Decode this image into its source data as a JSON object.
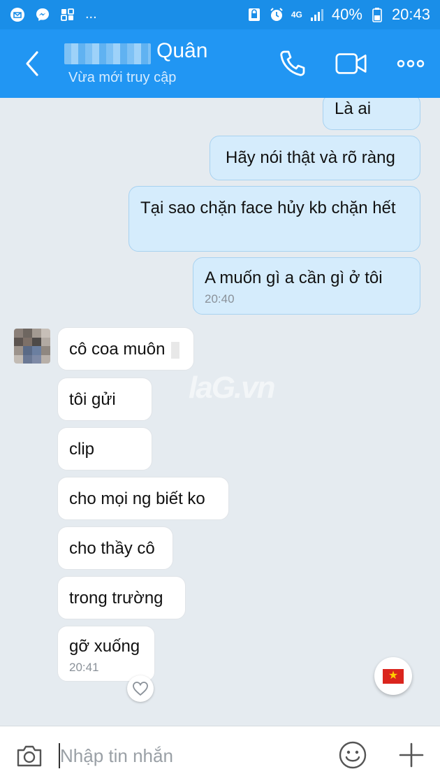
{
  "status_bar": {
    "more_indicator": "...",
    "network_label": "4G",
    "battery_percent": "40%",
    "time": "20:43"
  },
  "header": {
    "contact_name": "Quân",
    "contact_status": "Vừa mới truy cập"
  },
  "messages": [
    {
      "side": "me",
      "text": "Là ai"
    },
    {
      "side": "me",
      "text": "Hãy nói thật và rõ ràng"
    },
    {
      "side": "me",
      "text": "Tại sao chặn face   hủy kb   chặn hết"
    },
    {
      "side": "me",
      "text": "A muốn gì    a cần gì ở tôi",
      "time": "20:40"
    },
    {
      "side": "them",
      "text": "cô coa muôn"
    },
    {
      "side": "them",
      "text": "tôi gửi"
    },
    {
      "side": "them",
      "text": "clip"
    },
    {
      "side": "them",
      "text": "cho mọi ng biết ko"
    },
    {
      "side": "them",
      "text": "cho thầy cô"
    },
    {
      "side": "them",
      "text": "trong trường"
    },
    {
      "side": "them",
      "text": "gỡ xuống",
      "time": "20:41"
    }
  ],
  "watermark": "laG.vn",
  "input": {
    "placeholder": "Nhập tin nhắn"
  },
  "icons": {
    "back": "chevron-left-icon",
    "call": "phone-icon",
    "video": "video-camera-icon",
    "more": "more-dots-icon",
    "camera": "camera-icon",
    "emoji": "smiley-icon",
    "plus": "plus-icon",
    "heart": "heart-icon",
    "flag": "vietnam-flag-icon"
  },
  "colors": {
    "header_bg": "#2196f3",
    "status_bar_bg": "#1a8ee8",
    "chat_bg": "#e5ebf0",
    "my_bubble": "#d5ecfc",
    "their_bubble": "#ffffff"
  }
}
